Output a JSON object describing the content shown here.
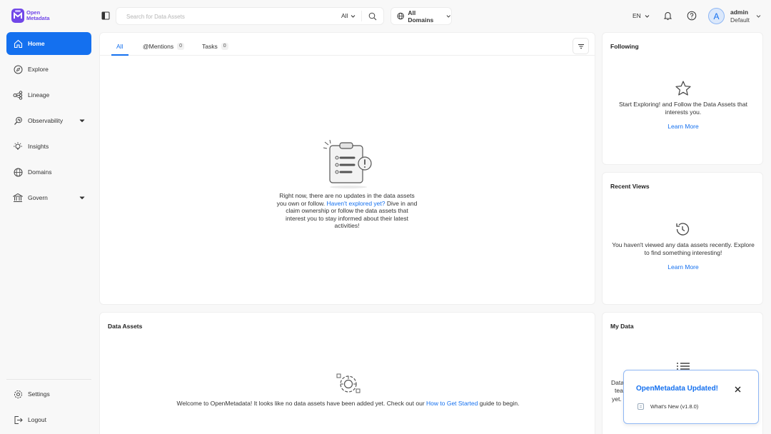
{
  "brand": {
    "line1": "Open",
    "line2": "Metadata"
  },
  "sidebar": {
    "items": [
      {
        "label": "Home",
        "icon": "home-icon",
        "active": true
      },
      {
        "label": "Explore",
        "icon": "compass-icon"
      },
      {
        "label": "Lineage",
        "icon": "lineage-icon"
      },
      {
        "label": "Observability",
        "icon": "observability-icon",
        "expandable": true
      },
      {
        "label": "Insights",
        "icon": "lightbulb-icon"
      },
      {
        "label": "Domains",
        "icon": "globe-icon"
      },
      {
        "label": "Govern",
        "icon": "bank-icon",
        "expandable": true
      }
    ],
    "bottom": [
      {
        "label": "Settings",
        "icon": "gear-icon"
      },
      {
        "label": "Logout",
        "icon": "logout-icon"
      }
    ]
  },
  "topbar": {
    "search_placeholder": "Search for Data Assets",
    "search_scope": "All",
    "domains_label": "All Domains",
    "language": "EN",
    "user": {
      "initial": "A",
      "name": "admin",
      "role": "Default"
    }
  },
  "feed": {
    "tabs": [
      {
        "label": "All",
        "active": true
      },
      {
        "label": "@Mentions",
        "count": "0"
      },
      {
        "label": "Tasks",
        "count": "0"
      }
    ],
    "empty_before": "Right now, there are no updates in the data assets you own or follow. ",
    "empty_link": "Haven't explored yet?",
    "empty_after": " Dive in and claim ownership or follow the data assets that interest you to stay informed about their latest activities!"
  },
  "following": {
    "title": "Following",
    "message": "Start Exploring! and Follow the Data Assets that interests you.",
    "link": "Learn More"
  },
  "recent_views": {
    "title": "Recent Views",
    "message": "You haven't viewed any data assets recently. Explore to find something interesting!",
    "link": "Learn More"
  },
  "data_assets": {
    "title": "Data Assets",
    "before": "Welcome to OpenMetadata! It looks like no data assets have been added yet. Check out our ",
    "link": "How to Get Started",
    "after": " guide to begin."
  },
  "my_data": {
    "title": "My Data",
    "partial_lines": [
      "Data",
      "tea",
      "yet."
    ]
  },
  "toast": {
    "title": "OpenMetadata Updated!",
    "item": "What's New (v1.8.0)"
  },
  "colors": {
    "accent": "#1470ef",
    "brand": "#7147e8"
  }
}
